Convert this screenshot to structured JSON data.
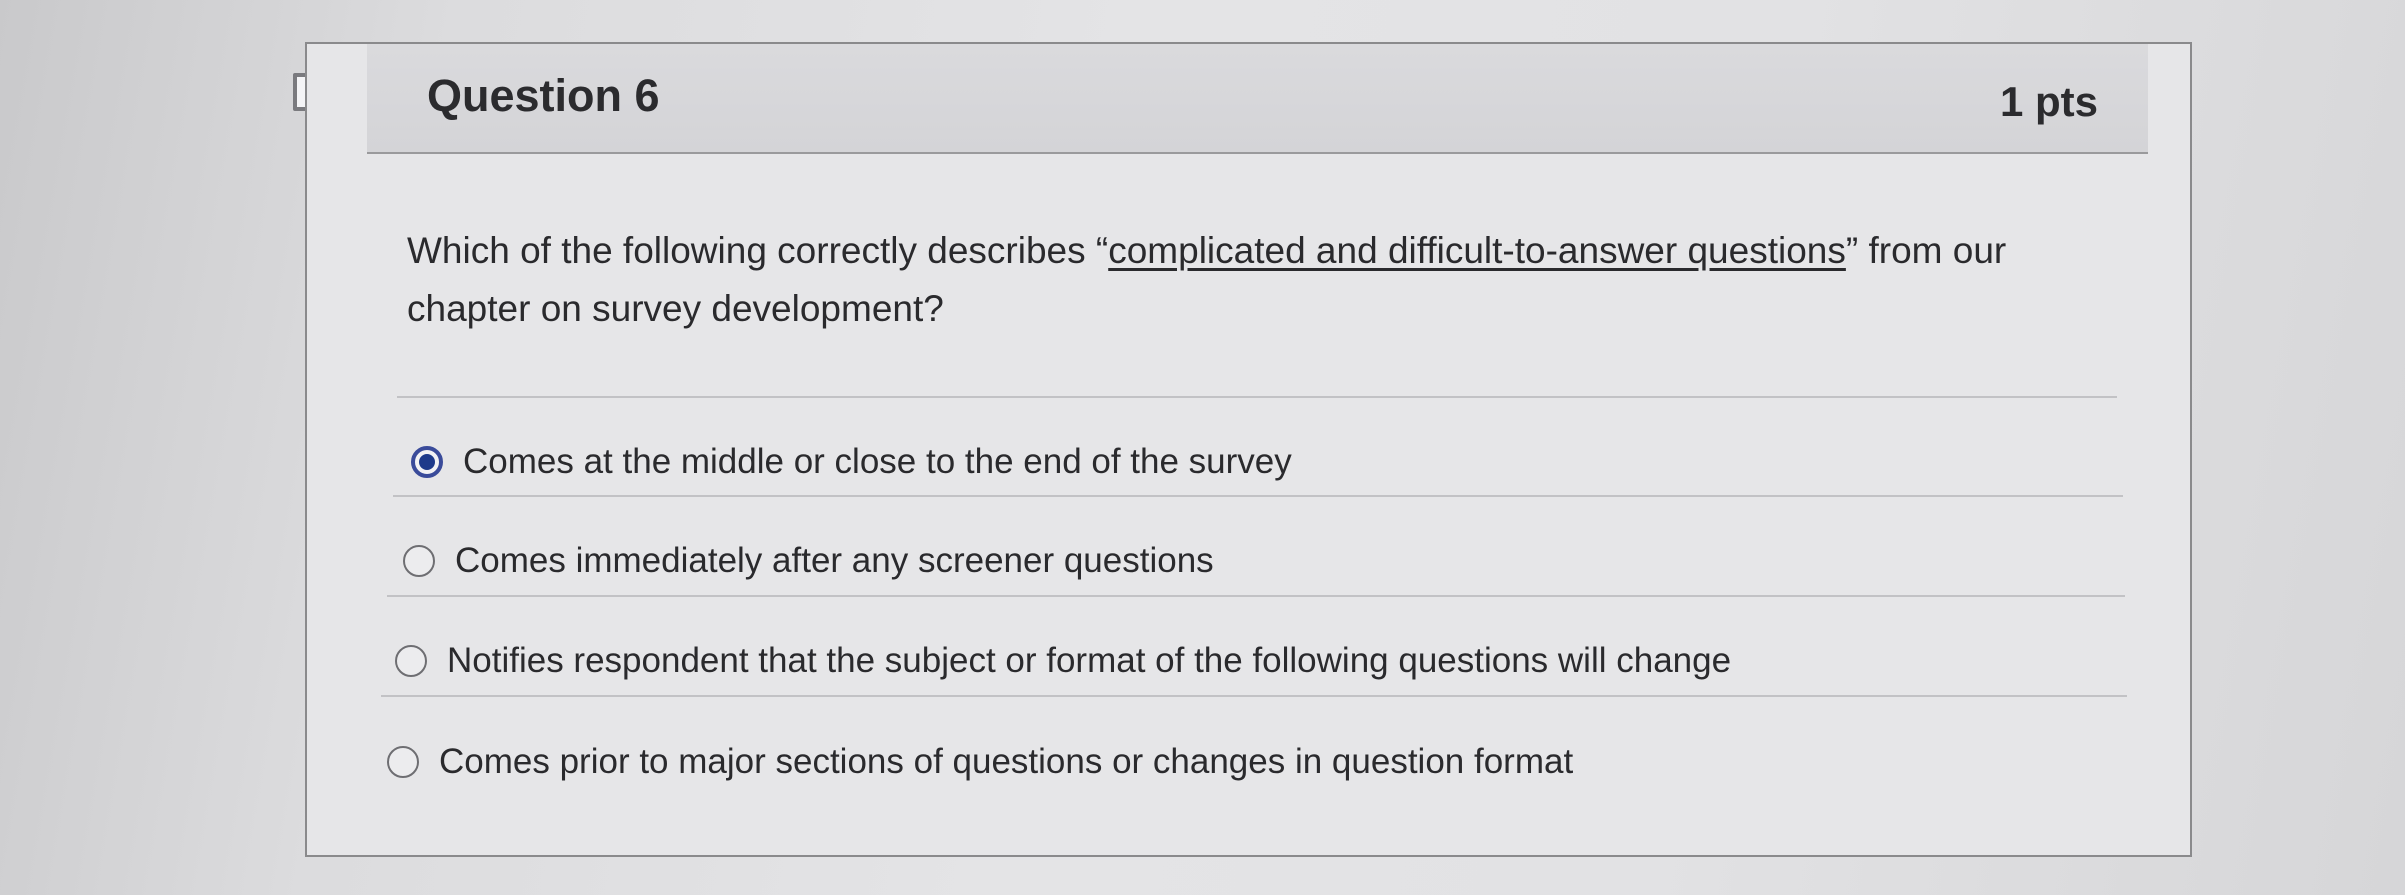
{
  "question": {
    "title": "Question 6",
    "points": "1 pts",
    "text_before": "Which of the following correctly describes “",
    "text_underlined": "complicated and difficult-to-answer questions",
    "text_after": "” from our chapter on survey development?"
  },
  "answers": [
    {
      "label": "Comes at the middle or close to the end of the survey",
      "selected": true
    },
    {
      "label": "Comes immediately after any screener questions",
      "selected": false
    },
    {
      "label": "Notifies respondent that the subject or format of the following questions will change",
      "selected": false
    },
    {
      "label": "Comes prior to major sections of questions or changes in question format",
      "selected": false
    }
  ],
  "colors": {
    "selected_radio": "#1e3a8a",
    "text": "#2a2a2d",
    "header_bg": "#d6d6d9"
  },
  "icons": {
    "flag": "flag-icon"
  }
}
